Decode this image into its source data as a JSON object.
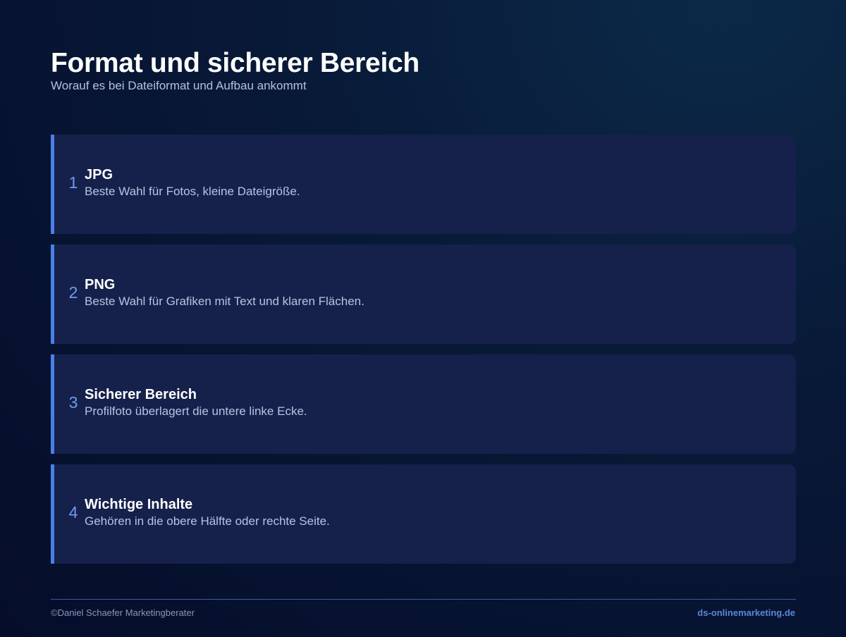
{
  "header": {
    "title": "Format und sicherer Bereich",
    "subtitle": "Worauf es bei Dateiformat und Aufbau ankommt"
  },
  "cards": [
    {
      "number": "1",
      "title": "JPG",
      "description": "Beste Wahl für Fotos, kleine Dateigröße."
    },
    {
      "number": "2",
      "title": "PNG",
      "description": "Beste Wahl für Grafiken mit Text und klaren Flächen."
    },
    {
      "number": "3",
      "title": "Sicherer Bereich",
      "description": "Profilfoto überlagert die untere linke Ecke."
    },
    {
      "number": "4",
      "title": "Wichtige Inhalte",
      "description": "Gehören in die obere Hälfte oder rechte Seite."
    }
  ],
  "footer": {
    "copyright": "©Daniel Schaefer Marketingberater",
    "website": "ds-onlinemarketing.de"
  },
  "colors": {
    "accent": "#4a80e6",
    "card_background": "#15214a",
    "page_background": "#050d2a"
  }
}
